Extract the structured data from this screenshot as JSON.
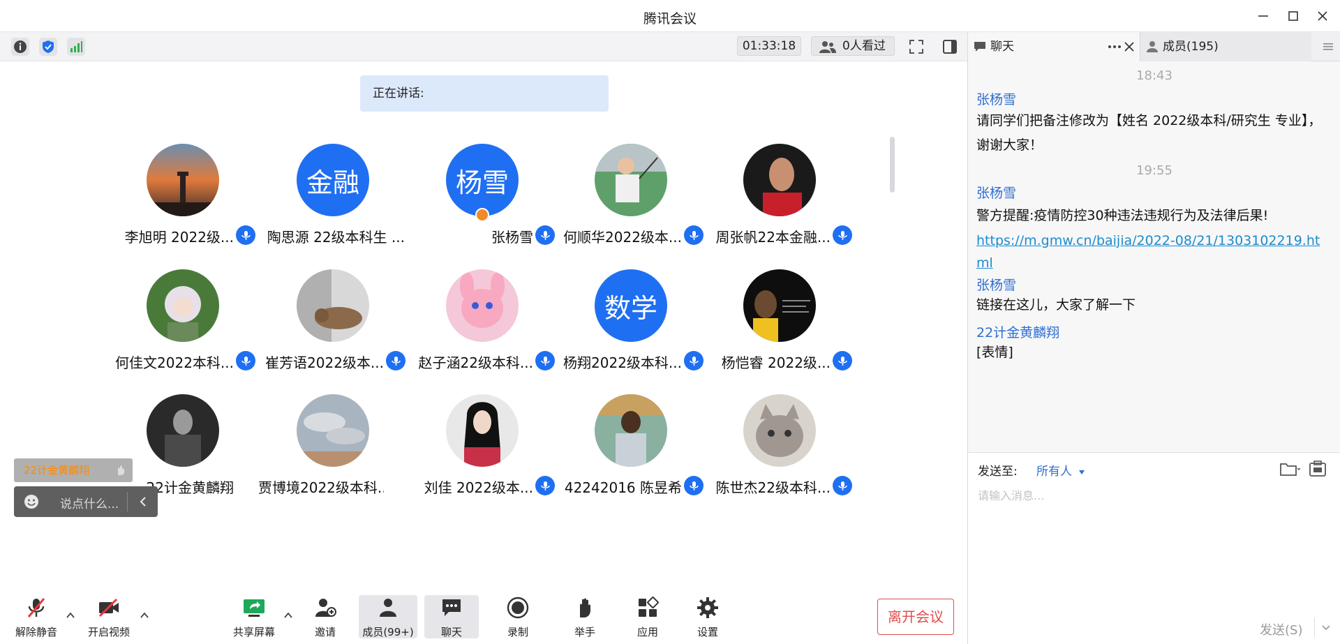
{
  "window": {
    "title": "腾讯会议"
  },
  "toolbar": {
    "timer": "01:33:18",
    "viewers": "0人看过"
  },
  "speaking": {
    "label": "正在讲话:"
  },
  "participants": [
    {
      "name": "李旭明 2022级...",
      "avatar": "sunset-lighthouse",
      "mic": true
    },
    {
      "name": "陶思源 22级本科生 ...",
      "avatar_text": "金融",
      "mic": false
    },
    {
      "name": "张杨雪",
      "avatar_text": "杨雪",
      "mic": true,
      "host": true
    },
    {
      "name": "何顺华2022级本...",
      "avatar": "badminton-player",
      "mic": true
    },
    {
      "name": "周张帆22本金融...",
      "avatar": "athlete-portrait",
      "mic": true
    },
    {
      "name": "何佳文2022本科...",
      "avatar": "anime-girl",
      "mic": true
    },
    {
      "name": "崔芳语2022级本...",
      "avatar": "cat-lying",
      "mic": true
    },
    {
      "name": "赵子涵22级本科...",
      "avatar": "pink-cartoon",
      "mic": true
    },
    {
      "name": "杨翔2022级本科...",
      "avatar_text": "数学",
      "mic": true
    },
    {
      "name": "杨恺睿 2022级...",
      "avatar": "basketball-player",
      "mic": true
    },
    {
      "name": "22计金黄麟翔",
      "avatar": "bw-figure",
      "mic": false
    },
    {
      "name": "贾博境2022级本科...",
      "avatar": "cloudy-sky",
      "mic": false
    },
    {
      "name": "刘佳 2022级本...",
      "avatar": "girl-portrait",
      "mic": true
    },
    {
      "name": "42242016 陈昱希",
      "avatar": "painting-figure",
      "mic": true
    },
    {
      "name": "陈世杰22级本科...",
      "avatar": "grey-cat",
      "mic": true
    }
  ],
  "overlay": {
    "floating_name": "22计金黄麟翔",
    "say_placeholder": "说点什么..."
  },
  "bottom_toolbar": {
    "mute": "解除静音",
    "video": "开启视频",
    "share": "共享屏幕",
    "invite": "邀请",
    "members": "成员(99+)",
    "chat": "聊天",
    "record": "录制",
    "raise_hand": "举手",
    "apps": "应用",
    "settings": "设置",
    "leave": "离开会议"
  },
  "right_panel": {
    "chat_tab": "聊天",
    "members_tab": "成员(195)",
    "messages": {
      "ts1": "18:43",
      "sender1": "张杨雪",
      "msg1": "请同学们把备注修改为【姓名 2022级本科/研究生 专业】，谢谢大家！",
      "ts2": "19:55",
      "sender2": "张杨雪",
      "msg2": "警方提醒:疫情防控30种违法违规行为及法律后果!",
      "link2": "https://m.gmw.cn/baijia/2022-08/21/1303102219.html",
      "sender3": "张杨雪",
      "msg3": "链接在这儿，大家了解一下",
      "sender4": "22计金黄麟翔",
      "msg4": "[表情]"
    },
    "compose": {
      "send_to_label": "发送至:",
      "send_to_value": "所有人",
      "placeholder": "请输入消息...",
      "send_button": "发送(S)"
    }
  },
  "colors": {
    "accent": "#1f6ff2",
    "leave": "#e24c4c",
    "host_badge": "#f08a26",
    "link": "#1a8ccf"
  }
}
